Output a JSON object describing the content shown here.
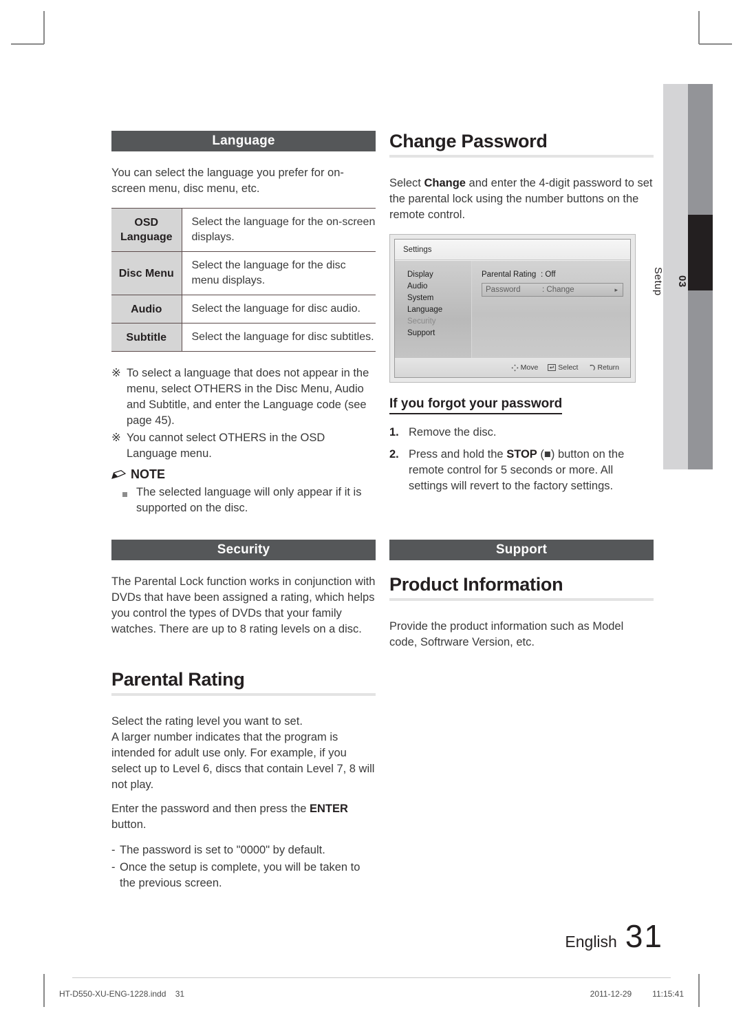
{
  "sidebar": {
    "chapter_number": "03",
    "chapter_label": "Setup"
  },
  "left_column": {
    "language_band": "Language",
    "language_intro": "You can select the language you prefer for on-screen menu, disc menu, etc.",
    "table": {
      "rows": [
        {
          "key": "OSD Language",
          "value": "Select the language for the on-screen displays."
        },
        {
          "key": "Disc Menu",
          "value": "Select the language for the disc menu displays."
        },
        {
          "key": "Audio",
          "value": "Select the language for disc audio."
        },
        {
          "key": "Subtitle",
          "value": "Select the language for disc subtitles."
        }
      ]
    },
    "asterisk_notes": [
      "To select a language that does not appear in the menu, select OTHERS in the Disc Menu, Audio and Subtitle, and enter the Language code (see page 45).",
      "You cannot select OTHERS in the OSD Language menu."
    ],
    "note_heading": "NOTE",
    "note_items": [
      "The selected language will only appear if it is supported on the disc."
    ],
    "security_band": "Security",
    "security_text": "The Parental Lock function works in conjunction with DVDs that have been assigned a rating, which helps you control the types of DVDs that your family watches. There are up to 8 rating levels on a disc.",
    "parental_rating_heading": "Parental Rating",
    "parental_rating_p1": "Select the rating level you want to set.",
    "parental_rating_p2": "A larger number indicates that the program is intended for adult use only. For example, if you select up to Level 6, discs that contain Level 7, 8 will not play.",
    "enter_line_prefix": "Enter the password and then press the ",
    "enter_line_bold": "ENTER",
    "enter_line_suffix": " button.",
    "dash_items": [
      "The password is set to \"0000\" by default.",
      "Once the setup is complete, you will be taken to the previous screen."
    ]
  },
  "right_column": {
    "change_password_heading": "Change Password",
    "change_password_prefix": "Select ",
    "change_password_bold": "Change",
    "change_password_suffix": " and enter the 4-digit password to set the parental lock using the number buttons on the remote control.",
    "osd": {
      "title": "Settings",
      "nav_items": [
        "Display",
        "Audio",
        "System",
        "Language",
        "Security",
        "Support"
      ],
      "nav_selected": "Security",
      "rows": [
        {
          "label": "Parental Rating",
          "value": ": Off",
          "selected": false
        },
        {
          "label": "Password",
          "value": ": Change",
          "selected": true
        }
      ],
      "footer": [
        {
          "icon": "move-icon",
          "label": "Move"
        },
        {
          "icon": "select-icon",
          "label": "Select"
        },
        {
          "icon": "return-icon",
          "label": "Return"
        }
      ],
      "arrow_glyph": "▸"
    },
    "forgot_heading": "If you forgot your password",
    "forgot_steps": [
      {
        "n": "1.",
        "prefix": "Remove the disc.",
        "bold": "",
        "suffix": ""
      },
      {
        "n": "2.",
        "prefix": "Press and hold the ",
        "bold": "STOP",
        "suffix": " (■) button on the remote control for 5 seconds or more. All settings will revert to the factory settings."
      }
    ],
    "support_band": "Support",
    "product_info_heading": "Product Information",
    "product_info_text": "Provide the product information such as Model code, Softrware Version, etc."
  },
  "footer": {
    "language_label": "English",
    "page_number": "31",
    "file_name": "HT-D550-XU-ENG-1228.indd",
    "file_page": "31",
    "date": "2011-12-29",
    "time": "11:15:41"
  },
  "colors": {
    "band": "#555759",
    "tab_light": "#d4d4d6",
    "tab_dark": "#939498",
    "tab_active": "#231f20",
    "table_key_bg": "#d5d5d5"
  }
}
